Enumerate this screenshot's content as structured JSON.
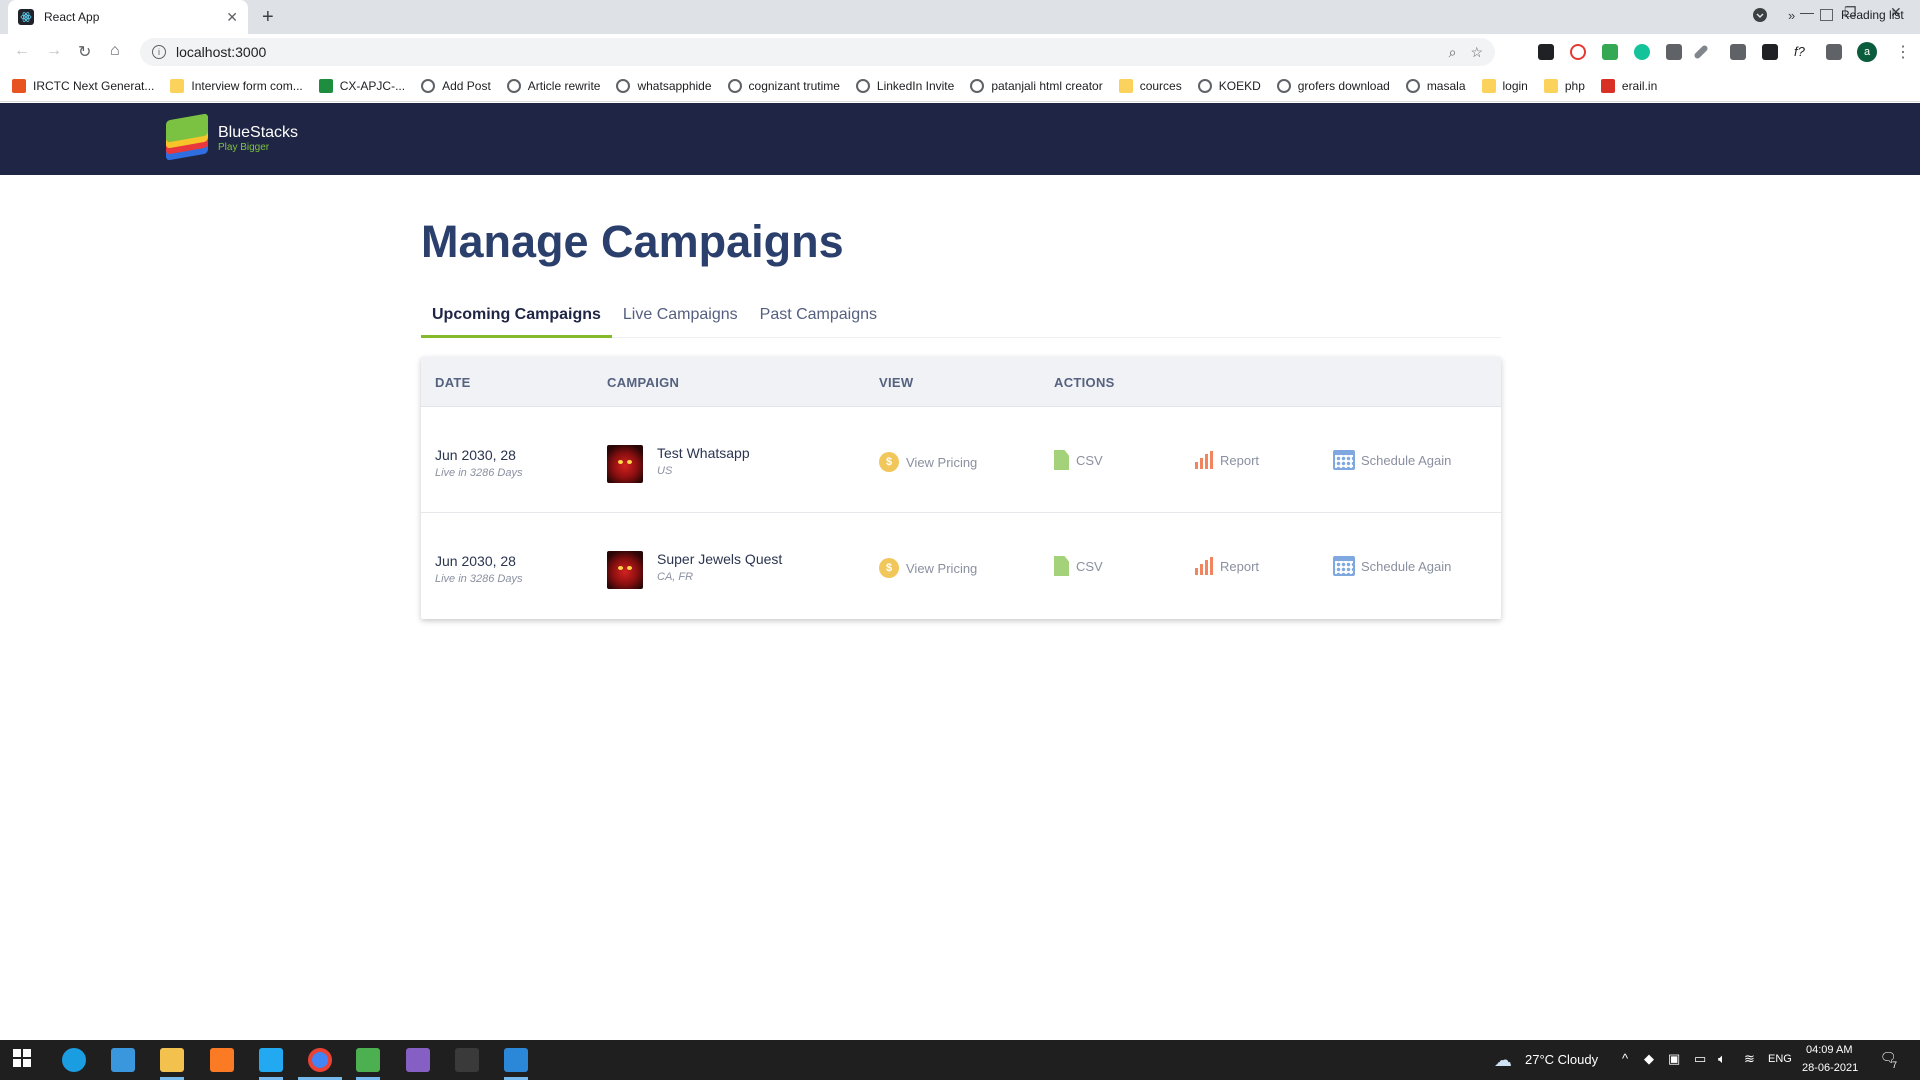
{
  "browser": {
    "tab_title": "React App",
    "url": "localhost:3000",
    "bookmarks": [
      {
        "label": "IRCTC Next Generat...",
        "icon": "red"
      },
      {
        "label": "Interview form com...",
        "icon": "folder"
      },
      {
        "label": "CX-APJC-...",
        "icon": "green"
      },
      {
        "label": "Add Post",
        "icon": "globe"
      },
      {
        "label": "Article rewrite",
        "icon": "globe"
      },
      {
        "label": "whatsapphide",
        "icon": "globe"
      },
      {
        "label": "cognizant trutime",
        "icon": "globe"
      },
      {
        "label": "LinkedIn Invite",
        "icon": "globe"
      },
      {
        "label": "patanjali html creator",
        "icon": "globe"
      },
      {
        "label": "cources",
        "icon": "folder"
      },
      {
        "label": "KOEKD",
        "icon": "globe"
      },
      {
        "label": "grofers download",
        "icon": "globe"
      },
      {
        "label": "masala",
        "icon": "globe"
      },
      {
        "label": "login",
        "icon": "folder"
      },
      {
        "label": "php",
        "icon": "folder"
      },
      {
        "label": "erail.in",
        "icon": "rail"
      }
    ],
    "more_label": "»",
    "reading_list": "Reading list",
    "avatar_letter": "a"
  },
  "header": {
    "brand": "BlueStacks",
    "tagline": "Play Bigger"
  },
  "page": {
    "title": "Manage Campaigns",
    "tabs": [
      "Upcoming Campaigns",
      "Live Campaigns",
      "Past Campaigns"
    ],
    "active_tab": "Upcoming Campaigns"
  },
  "table": {
    "columns": {
      "date": "DATE",
      "campaign": "CAMPAIGN",
      "view": "VIEW",
      "actions": "ACTIONS"
    },
    "rows": [
      {
        "date": "Jun 2030, 28",
        "days": "Live in 3286 Days",
        "name": "Test Whatsapp",
        "region": "US",
        "view": "View Pricing",
        "csv": "CSV",
        "report": "Report",
        "schedule": "Schedule Again"
      },
      {
        "date": "Jun 2030, 28",
        "days": "Live in 3286 Days",
        "name": "Super Jewels Quest",
        "region": "CA, FR",
        "view": "View Pricing",
        "csv": "CSV",
        "report": "Report",
        "schedule": "Schedule Again"
      }
    ]
  },
  "taskbar": {
    "weather": "27°C  Cloudy",
    "lang": "ENG",
    "time": "04:09 AM",
    "date": "28-06-2021",
    "notifications": "7"
  },
  "colors": {
    "header_bg": "#1f2544",
    "title": "#2b3f6c",
    "active_tab_underline": "#83b92b",
    "coin": "#f1c75b",
    "csv": "#a4d27a",
    "report": "#f0855f",
    "calendar": "#7fa8e0"
  }
}
